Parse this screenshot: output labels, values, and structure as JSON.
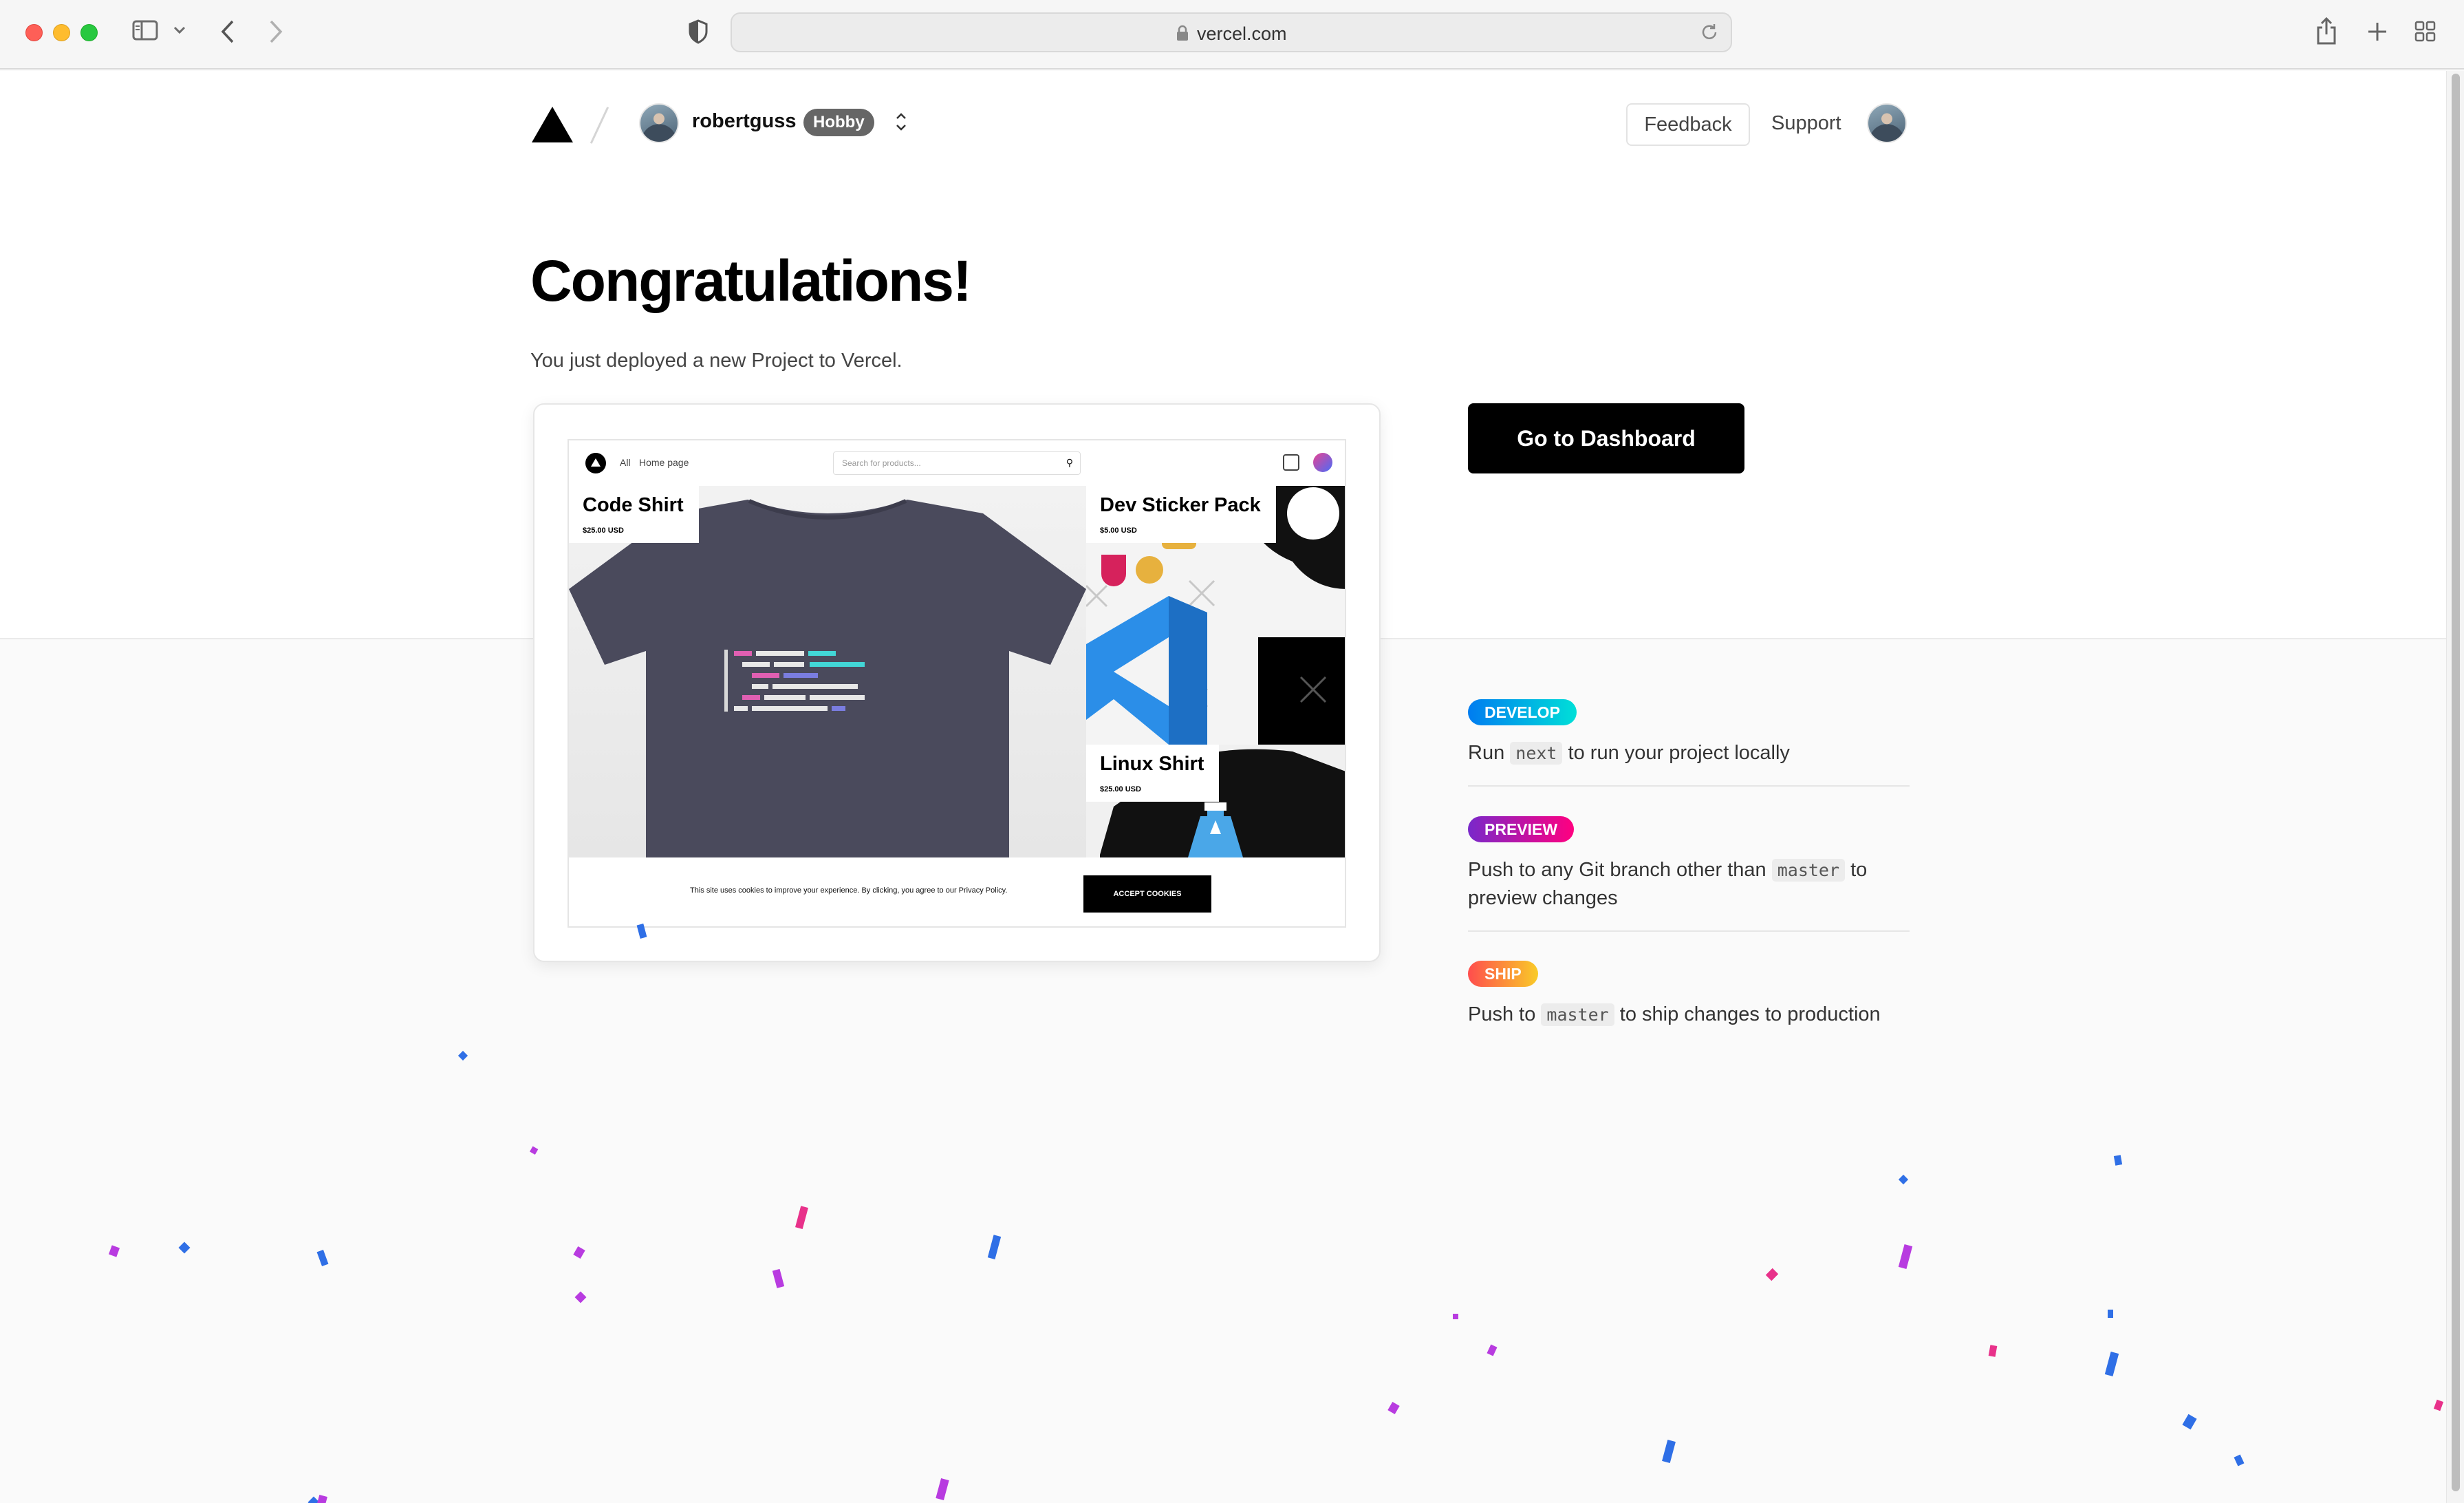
{
  "browser": {
    "url": "vercel.com"
  },
  "header": {
    "team_name": "robertguss",
    "plan_badge": "Hobby",
    "feedback_label": "Feedback",
    "support_label": "Support"
  },
  "hero": {
    "title": "Congratulations!",
    "subtitle": "You just deployed a new Project to Vercel."
  },
  "preview": {
    "nav": {
      "all": "All",
      "home": "Home page",
      "search_placeholder": "Search for products..."
    },
    "products": [
      {
        "name": "Code Shirt",
        "price": "$25.00 USD"
      },
      {
        "name": "Dev Sticker Pack",
        "price": "$5.00 USD"
      },
      {
        "name": "Linux Shirt",
        "price": "$25.00 USD"
      }
    ],
    "cookie": {
      "text": "This site uses cookies to improve your experience. By clicking, you agree to our Privacy Policy.",
      "button": "ACCEPT COOKIES"
    }
  },
  "actions": {
    "dashboard_button": "Go to Dashboard"
  },
  "steps": [
    {
      "badge": "DEVELOP",
      "before": "Run ",
      "code": "next",
      "after": " to run your project locally"
    },
    {
      "badge": "PREVIEW",
      "before": "Push to any Git branch other than ",
      "code": "master",
      "after": " to preview changes"
    },
    {
      "badge": "SHIP",
      "before": "Push to ",
      "code": "master",
      "after": " to ship changes to production"
    }
  ],
  "colors": {
    "confetti_blue": "#2f6fe6",
    "confetti_pink": "#e8318a",
    "confetti_purple": "#b83be0"
  }
}
